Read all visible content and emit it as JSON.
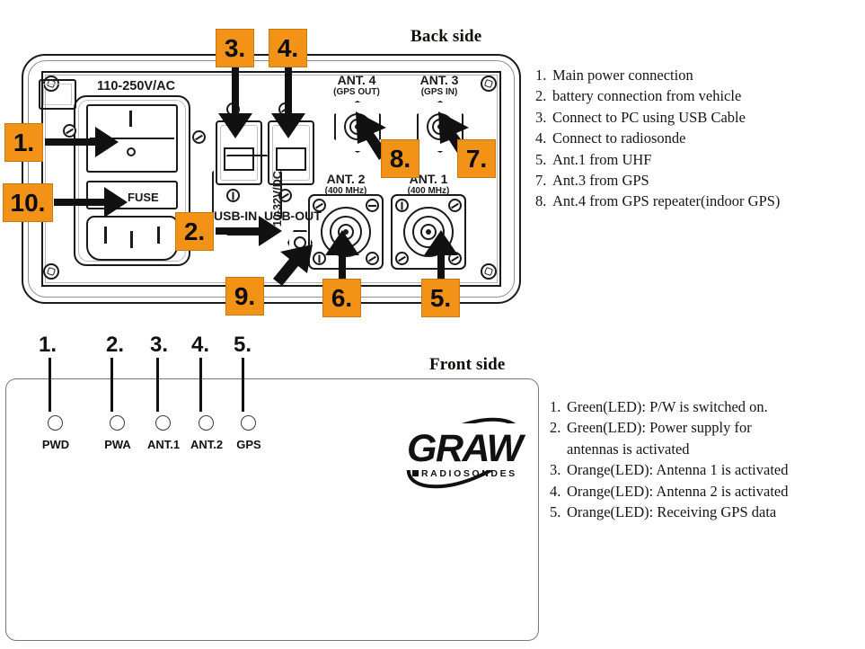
{
  "headings": {
    "back": "Back side",
    "front": "Front side"
  },
  "back_list": [
    {
      "num": "1.",
      "text": "Main power connection"
    },
    {
      "num": "2.",
      "text": "battery connection from vehicle"
    },
    {
      "num": "3.",
      "text": "Connect to PC using USB Cable"
    },
    {
      "num": "4.",
      "text": "Connect to radiosonde"
    },
    {
      "num": "5.",
      "text": "Ant.1 from UHF"
    },
    {
      "num": "7.",
      "text": "Ant.3 from GPS"
    },
    {
      "num": "8.",
      "text": "Ant.4 from GPS repeater(indoor GPS)"
    }
  ],
  "front_list": [
    {
      "num": "1.",
      "text": "Green(LED):  P/W is switched on.",
      "cont": ""
    },
    {
      "num": "2.",
      "text": "Green(LED):  Power supply for",
      "cont": "antennas is activated"
    },
    {
      "num": "3.",
      "text": "Orange(LED):  Antenna 1 is activated",
      "cont": ""
    },
    {
      "num": "4.",
      "text": "Orange(LED):  Antenna 2 is activated",
      "cont": ""
    },
    {
      "num": "5.",
      "text": "Orange(LED):  Receiving GPS data",
      "cont": ""
    }
  ],
  "back_panel": {
    "labels": {
      "voltage": "110-250V/AC",
      "fuse": "FUSE",
      "usb_in": "USB-IN",
      "usb_out": "USB-OUT",
      "dc": "10-32V/DC"
    },
    "antennas": [
      {
        "name": "ANT. 4",
        "freq": "(GPS OUT)"
      },
      {
        "name": "ANT. 3",
        "freq": "(GPS IN)"
      },
      {
        "name": "ANT. 2",
        "freq": "(400 MHz)"
      },
      {
        "name": "ANT. 1",
        "freq": "(400 MHz)"
      }
    ],
    "callouts": [
      {
        "id": "1",
        "label": "1."
      },
      {
        "id": "2",
        "label": "2."
      },
      {
        "id": "3",
        "label": "3."
      },
      {
        "id": "4",
        "label": "4."
      },
      {
        "id": "5",
        "label": "5."
      },
      {
        "id": "6",
        "label": "6."
      },
      {
        "id": "7",
        "label": "7."
      },
      {
        "id": "8",
        "label": "8."
      },
      {
        "id": "9",
        "label": "9."
      },
      {
        "id": "10",
        "label": "10."
      }
    ]
  },
  "front_panel": {
    "leds": [
      {
        "num": "1.",
        "label": "PWD"
      },
      {
        "num": "2.",
        "label": "PWA"
      },
      {
        "num": "3.",
        "label": "ANT.1"
      },
      {
        "num": "4.",
        "label": "ANT.2"
      },
      {
        "num": "5.",
        "label": "GPS"
      }
    ],
    "logo": {
      "word": "GRAW",
      "sub": "RADIOSONDES"
    }
  },
  "colors": {
    "badge_orange": "#F29318",
    "badge_border": "#c87a10",
    "outline": "#1a1a1a"
  }
}
